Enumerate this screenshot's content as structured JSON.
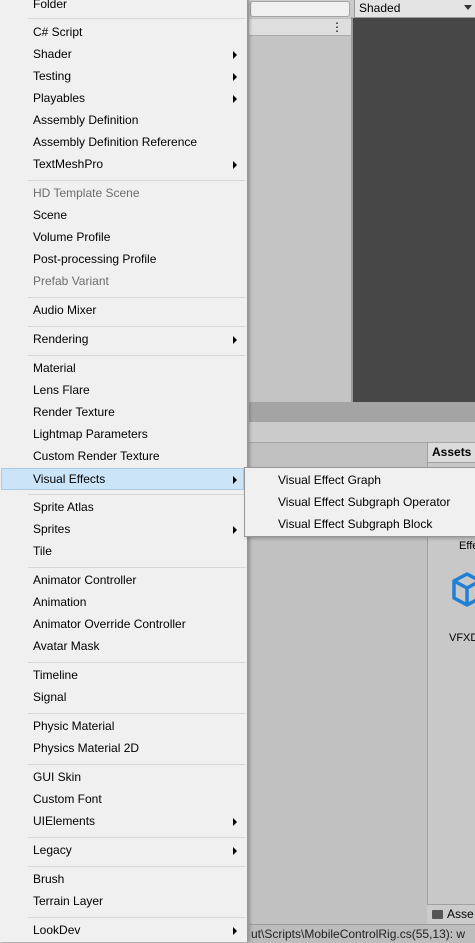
{
  "menu": {
    "items": [
      {
        "label": "Folder"
      },
      {
        "label": "C# Script"
      },
      {
        "label": "Shader",
        "submenu": true
      },
      {
        "label": "Testing",
        "submenu": true
      },
      {
        "label": "Playables",
        "submenu": true
      },
      {
        "label": "Assembly Definition"
      },
      {
        "label": "Assembly Definition Reference"
      },
      {
        "label": "TextMeshPro",
        "submenu": true
      },
      {
        "label": "HD Template Scene",
        "disabled": true
      },
      {
        "label": "Scene"
      },
      {
        "label": "Volume Profile"
      },
      {
        "label": "Post-processing Profile"
      },
      {
        "label": "Prefab Variant",
        "disabled": true
      },
      {
        "label": "Audio Mixer"
      },
      {
        "label": "Rendering",
        "submenu": true
      },
      {
        "label": "Material"
      },
      {
        "label": "Lens Flare"
      },
      {
        "label": "Render Texture"
      },
      {
        "label": "Lightmap Parameters"
      },
      {
        "label": "Custom Render Texture"
      },
      {
        "label": "Visual Effects",
        "submenu": true,
        "highlighted": true
      },
      {
        "label": "Sprite Atlas"
      },
      {
        "label": "Sprites",
        "submenu": true
      },
      {
        "label": "Tile"
      },
      {
        "label": "Animator Controller"
      },
      {
        "label": "Animation"
      },
      {
        "label": "Animator Override Controller"
      },
      {
        "label": "Avatar Mask"
      },
      {
        "label": "Timeline"
      },
      {
        "label": "Signal"
      },
      {
        "label": "Physic Material"
      },
      {
        "label": "Physics Material 2D"
      },
      {
        "label": "GUI Skin"
      },
      {
        "label": "Custom Font"
      },
      {
        "label": "UIElements",
        "submenu": true
      },
      {
        "label": "Legacy",
        "submenu": true
      },
      {
        "label": "Brush"
      },
      {
        "label": "Terrain Layer"
      },
      {
        "label": "LookDev",
        "submenu": true
      }
    ]
  },
  "submenu": {
    "items": [
      {
        "label": "Visual Effect Graph"
      },
      {
        "label": "Visual Effect Subgraph Operator"
      },
      {
        "label": "Visual Effect Subgraph Block"
      }
    ]
  },
  "editor": {
    "shading_mode": "Shaded",
    "panel_menu_glyph": "⋮",
    "assets_tab": "Assets",
    "asset_label_partial": "Effe",
    "asset_name_partial": "VFXD",
    "assets_footer": "Asse",
    "status_text": "ut\\Scripts\\MobileControlRig.cs(55,13): w"
  },
  "colors": {
    "menu_bg": "#f0f0f0",
    "highlight_bg": "#cce4f7",
    "highlight_border": "#a9cbe8",
    "disabled_text": "#6d6d6d",
    "scene_view": "#474747",
    "vfx_icon": "#1f80d6"
  }
}
